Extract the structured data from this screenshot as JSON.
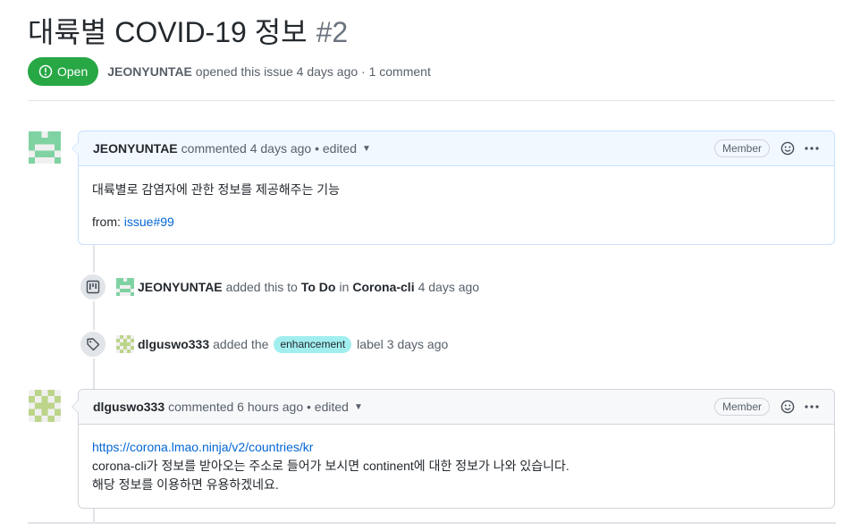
{
  "issue": {
    "title": "대륙별 COVID-19 정보",
    "number": "#2",
    "state": "Open",
    "author": "JEONYUNTAE",
    "opened_text": "opened this issue 4 days ago · 1 comment"
  },
  "comments": [
    {
      "author": "JEONYUNTAE",
      "meta": "commented 4 days ago • edited",
      "badge": "Member",
      "body_line1": "대륙별로 감염자에 관한 정보를 제공해주는 기능",
      "from_label": "from:",
      "from_link": "issue#99"
    },
    {
      "author": "dlguswo333",
      "meta": "commented 6 hours ago • edited",
      "badge": "Member",
      "link": "https://corona.lmao.ninja/v2/countries/kr",
      "line2": "corona-cli가 정보를 받아오는 주소로 들어가 보시면 continent에 대한 정보가 나와 있습니다.",
      "line3": "해당 정보를 이용하면 유용하겠네요."
    }
  ],
  "events": [
    {
      "icon": "project-icon",
      "actor": "JEONYUNTAE",
      "text1": "added this to",
      "column": "To Do",
      "text2": "in",
      "project": "Corona-cli",
      "time": "4 days ago"
    },
    {
      "icon": "tag-icon",
      "actor": "dlguswo333",
      "text1": "added the",
      "label": "enhancement",
      "text2": "label",
      "time": "3 days ago"
    }
  ],
  "colors": {
    "open_green": "#28a745",
    "link_blue": "#0366d6",
    "label_enhancement": "#a2eeef"
  }
}
